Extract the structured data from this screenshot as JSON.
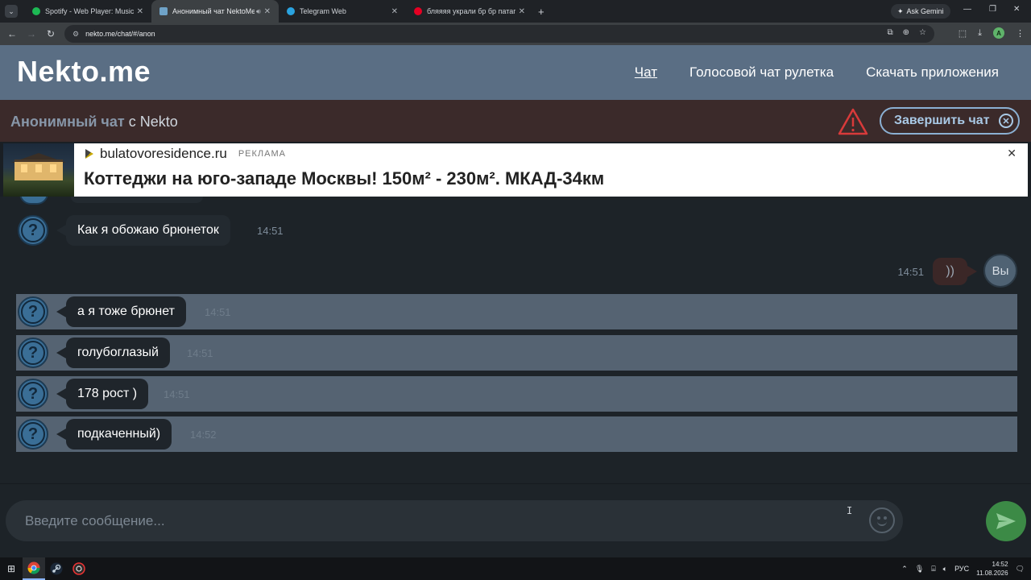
{
  "browser": {
    "tabs": [
      {
        "title": "Spotify - Web Player: Music for",
        "favicon_color": "#1db954",
        "active": false
      },
      {
        "title": "Анонимный чат NektoMe",
        "favicon_color": "#6fa3c8",
        "active": true
      },
      {
        "title": "Telegram Web",
        "favicon_color": "#2aa3e0",
        "active": false
      },
      {
        "title": "бляяяя украли бр бр патапим",
        "favicon_color": "#e60023",
        "active": false
      }
    ],
    "ask_label": "Ask Gemini",
    "url": "nekto.me/chat/#/anon",
    "profile_initial": "A"
  },
  "site": {
    "logo": "Nekto.me",
    "nav": [
      "Чат",
      "Голосовой чат рулетка",
      "Скачать приложения"
    ]
  },
  "chat_header": {
    "title_muted": "Анонимный чат",
    "title_rest": "с Nekto",
    "end_button": "Завершить чат"
  },
  "ad": {
    "domain": "bulatovoresidence.ru",
    "tag": "РЕКЛАМА",
    "headline": "Коттеджи на юго-западе Москвы! 150м² - 230м². МКАД-34км"
  },
  "messages": [
    {
      "text": "Как я обожаю брюнеток",
      "time": "14:51",
      "from": "them",
      "highlight": false
    },
    {
      "text": "))",
      "time": "14:51",
      "from": "me"
    },
    {
      "text": "а я тоже брюнет",
      "time": "14:51",
      "from": "them",
      "highlight": true
    },
    {
      "text": "голубоглазый",
      "time": "14:51",
      "from": "them",
      "highlight": true
    },
    {
      "text": "178 рост )",
      "time": "14:51",
      "from": "them",
      "highlight": true
    },
    {
      "text": "подкаченный)",
      "time": "14:52",
      "from": "them",
      "highlight": true
    }
  ],
  "me_avatar_label": "Вы",
  "composer": {
    "placeholder": "Введите сообщение..."
  },
  "taskbar": {
    "lang": "РУС",
    "time": "14:52",
    "date": "11.08.2026"
  }
}
